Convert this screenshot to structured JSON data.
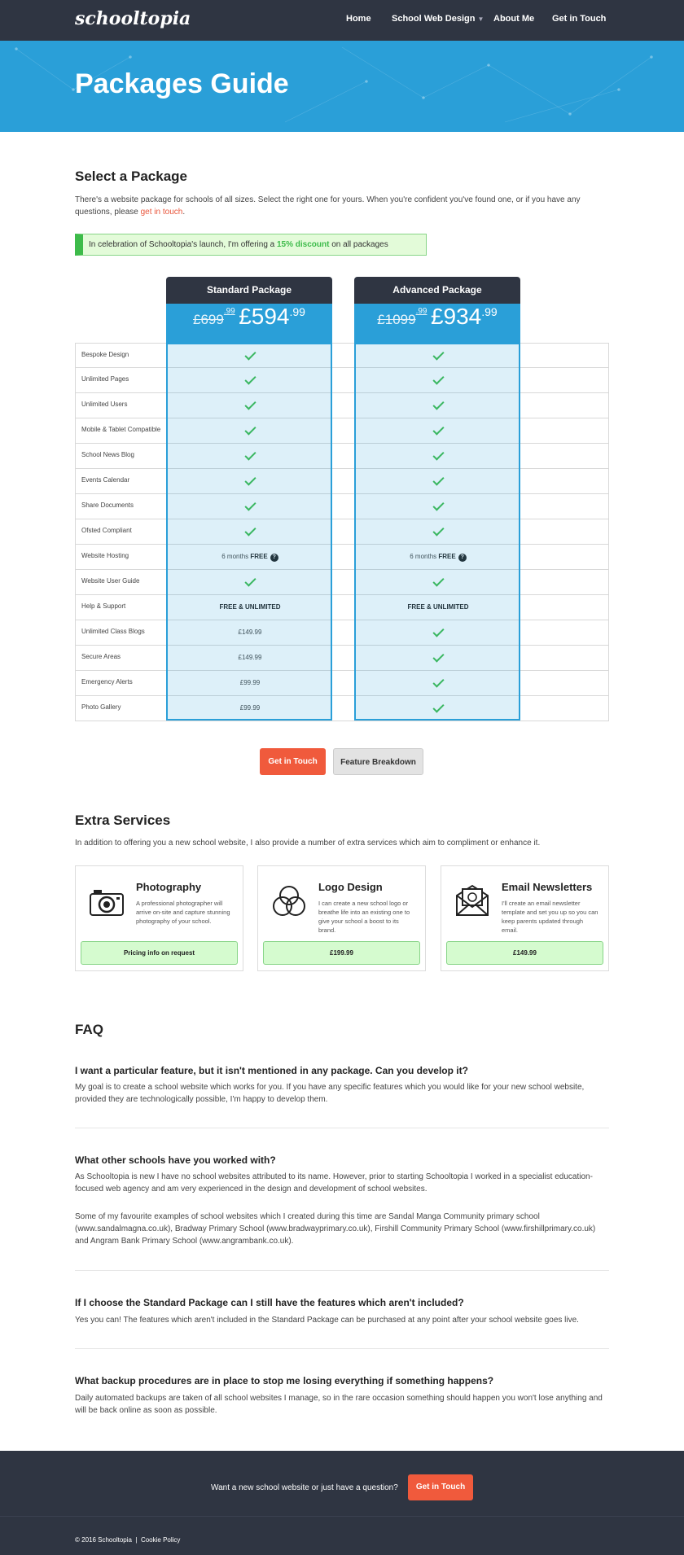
{
  "nav": {
    "logo": "schooltopia",
    "items": [
      {
        "label": "Home"
      },
      {
        "label": "School Web Design"
      },
      {
        "label": "About Me"
      },
      {
        "label": "Get in Touch"
      }
    ]
  },
  "hero": {
    "title": "Packages Guide"
  },
  "select": {
    "heading": "Select a Package",
    "intro": "There's a website package for schools of all sizes. Select the right one for yours. When you're confident you've found one, or if you have any questions, please ",
    "intro_link": "get in touch",
    "intro_end": ".",
    "promo_pre": "In celebration of Schooltopia's launch, I'm offering a ",
    "promo_bold": "15% discount",
    "promo_post": " on all packages"
  },
  "packages": [
    {
      "name": "Standard Package",
      "old_whole": "£699",
      "old_frac": ".99",
      "new_whole": "£594",
      "new_frac": ".99"
    },
    {
      "name": "Advanced Package",
      "old_whole": "£1099",
      "old_frac": ".99",
      "new_whole": "£934",
      "new_frac": ".99"
    }
  ],
  "features": [
    {
      "name": "Bespoke Design",
      "std": "check",
      "adv": "check"
    },
    {
      "name": "Unlimited Pages",
      "std": "check",
      "adv": "check"
    },
    {
      "name": "Unlimited Users",
      "std": "check",
      "adv": "check"
    },
    {
      "name": "Mobile & Tablet Compatible",
      "std": "check",
      "adv": "check"
    },
    {
      "name": "School News Blog",
      "std": "check",
      "adv": "check"
    },
    {
      "name": "Events Calendar",
      "std": "check",
      "adv": "check"
    },
    {
      "name": "Share Documents",
      "std": "check",
      "adv": "check"
    },
    {
      "name": "Ofsted Compliant",
      "std": "check",
      "adv": "check"
    },
    {
      "name": "Website Hosting",
      "std": "6 months |FREE",
      "adv": "6 months |FREE"
    },
    {
      "name": "Website User Guide",
      "std": "check",
      "adv": "check"
    },
    {
      "name": "Help & Support",
      "std": "FREE & UNLIMITED",
      "adv": "FREE & UNLIMITED"
    },
    {
      "name": "Unlimited Class Blogs",
      "std": "£149.99",
      "adv": "check"
    },
    {
      "name": "Secure Areas",
      "std": "£149.99",
      "adv": "check"
    },
    {
      "name": "Emergency Alerts",
      "std": "£99.99",
      "adv": "check"
    },
    {
      "name": "Photo Gallery",
      "std": "£99.99",
      "adv": "check"
    }
  ],
  "buttons": {
    "get_in_touch": "Get in Touch",
    "feature_breakdown": "Feature Breakdown"
  },
  "extras": {
    "heading": "Extra Services",
    "intro": "In addition to offering you a new school website, I also provide a number of extra services which aim to compliment or enhance it.",
    "items": [
      {
        "title": "Photography",
        "desc": "A professional photographer will arrive on-site and capture stunning photography of your school.",
        "price": "Pricing info on request",
        "icon": "camera-icon"
      },
      {
        "title": "Logo Design",
        "desc": "I can create a new school logo or breathe life into an existing one to give your school a boost to its brand.",
        "price": "£199.99",
        "icon": "logo-rings-icon"
      },
      {
        "title": "Email Newsletters",
        "desc": "I'll create an email newsletter template and set you up so you can keep parents updated through email.",
        "price": "£149.99",
        "icon": "envelope-icon"
      }
    ]
  },
  "faq": {
    "heading": "FAQ",
    "items": [
      {
        "q": "I want a particular feature, but it isn't mentioned in any package. Can you develop it?",
        "a": [
          "My goal is to create a school website which works for you. If you have any specific features which you would like for your new school website, provided they are technologically possible, I'm happy to develop them."
        ]
      },
      {
        "q": "What other schools have you worked with?",
        "a": [
          "As Schooltopia is new I have no school websites attributed to its name. However, prior to starting Schooltopia I worked in a specialist education-focused web agency and am very experienced in the design and development of school websites.",
          "Some of my favourite examples of school websites which I created during this time are Sandal Manga Community primary school (www.sandalmagna.co.uk), Bradway Primary School (www.bradwayprimary.co.uk), Firshill Community Primary School (www.firshillprimary.co.uk) and Angram Bank Primary School (www.angrambank.co.uk)."
        ]
      },
      {
        "q": "If I choose the Standard Package can I still have the features which aren't included?",
        "a": [
          "Yes you can! The features which aren't included in the Standard Package can be purchased at any point after your school website goes live."
        ]
      },
      {
        "q": "What backup procedures are in place to stop me losing everything if something happens?",
        "a": [
          "Daily automated backups are taken of all school websites I manage, so in the rare occasion something should happen you won't lose anything and will be back online as soon as possible."
        ]
      }
    ]
  },
  "footer": {
    "cta_text": "Want a new school website or just have a question?",
    "cta_button": "Get in Touch",
    "copyright": "© 2016 Schooltopia",
    "sep": "|",
    "cookie": "Cookie Policy"
  },
  "colors": {
    "nav": "#2f3542",
    "accent_blue": "#2a9fd8",
    "accent_red": "#f05a3c",
    "green": "#3dbb4a"
  }
}
